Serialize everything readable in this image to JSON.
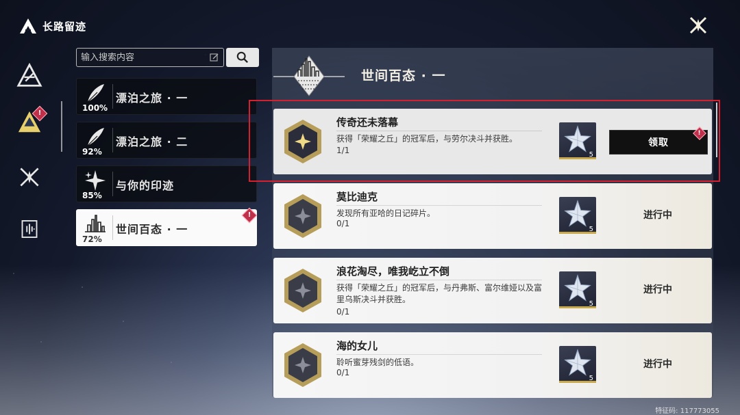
{
  "header": {
    "title": "长路留迹"
  },
  "search": {
    "placeholder": "输入搜索内容"
  },
  "categories": [
    {
      "label": "漂泊之旅 · 一",
      "percent": "100%",
      "icon": "feather-icon"
    },
    {
      "label": "漂泊之旅 · 二",
      "percent": "92%",
      "icon": "feather-icon"
    },
    {
      "label": "与你的印迹",
      "percent": "85%",
      "icon": "sparkle-icon"
    },
    {
      "label": "世间百态 · 一",
      "percent": "72%",
      "icon": "city-icon",
      "active": true,
      "badge": "!"
    }
  ],
  "rail": {
    "badge": "!"
  },
  "panel": {
    "title": "世间百态 · 一"
  },
  "achievements": [
    {
      "title": "传奇还未落幕",
      "desc": "获得「荣耀之丘」的冠军后，与劳尔决斗并获胜。",
      "progress": "1/1",
      "reward_qty": "5",
      "action": "领取",
      "claimable": true,
      "badge": "!"
    },
    {
      "title": "莫比迪克",
      "desc": "发现所有亚哈的日记碎片。",
      "progress": "0/1",
      "reward_qty": "5",
      "action": "进行中"
    },
    {
      "title": "浪花淘尽，唯我屹立不倒",
      "desc": "获得「荣耀之丘」的冠军后，与丹弗斯、富尔维娅以及富里乌斯决斗并获胜。",
      "progress": "0/1",
      "reward_qty": "5",
      "action": "进行中"
    },
    {
      "title": "海的女儿",
      "desc": "聆听蜜芽残剑的低语。",
      "progress": "0/1",
      "reward_qty": "5",
      "action": "进行中"
    }
  ],
  "footer": {
    "uid": "特征码: 117773055"
  },
  "colors": {
    "highlight": "#d7202f",
    "badge": "#c0304a",
    "gold": "#c9a94a"
  }
}
